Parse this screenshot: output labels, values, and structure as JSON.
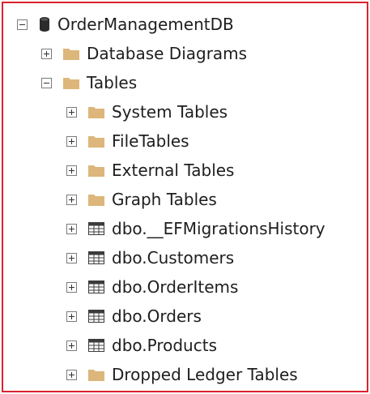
{
  "tree": {
    "root": {
      "label": "OrderManagementDB",
      "expanded": true,
      "icon": "database-icon"
    },
    "database_diagrams": {
      "label": "Database Diagrams",
      "expanded": false,
      "icon": "folder-icon"
    },
    "tables": {
      "label": "Tables",
      "expanded": true,
      "icon": "folder-icon"
    },
    "children": [
      {
        "label": "System Tables",
        "icon": "folder-icon"
      },
      {
        "label": "FileTables",
        "icon": "folder-icon"
      },
      {
        "label": "External Tables",
        "icon": "folder-icon"
      },
      {
        "label": "Graph Tables",
        "icon": "folder-icon"
      },
      {
        "label": "dbo.__EFMigrationsHistory",
        "icon": "table-icon"
      },
      {
        "label": "dbo.Customers",
        "icon": "table-icon"
      },
      {
        "label": "dbo.OrderItems",
        "icon": "table-icon"
      },
      {
        "label": "dbo.Orders",
        "icon": "table-icon"
      },
      {
        "label": "dbo.Products",
        "icon": "table-icon"
      },
      {
        "label": "Dropped Ledger Tables",
        "icon": "folder-icon"
      }
    ]
  },
  "colors": {
    "frame_border": "#d9232e",
    "folder": "#dcb67a",
    "database": "#2b2b2b",
    "table_icon": "#3c3c3c"
  }
}
